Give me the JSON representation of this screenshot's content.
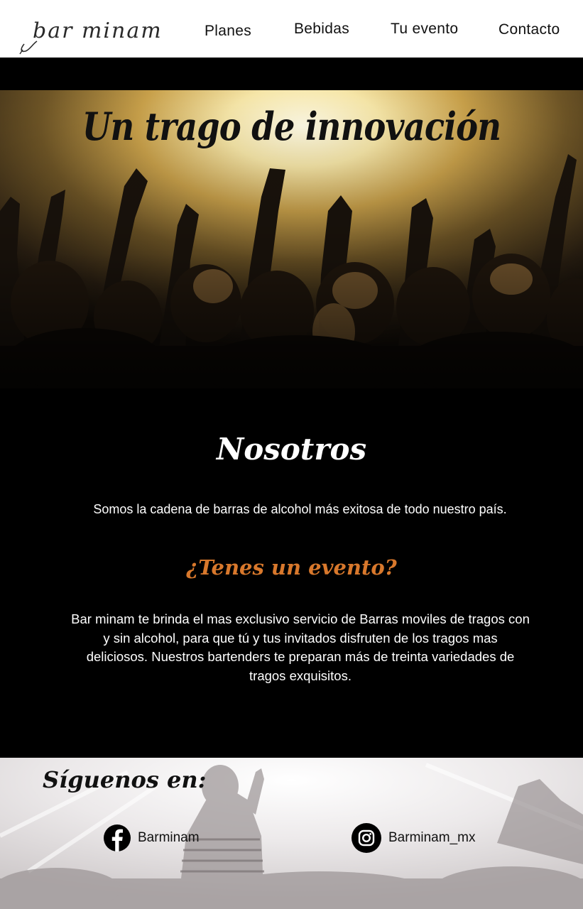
{
  "header": {
    "logo_text": "bar minam",
    "nav": [
      {
        "label": "Planes"
      },
      {
        "label": "Bebidas"
      },
      {
        "label": "Tu evento"
      },
      {
        "label": "Contacto"
      }
    ]
  },
  "hero": {
    "title": "Un trago de innovación"
  },
  "about": {
    "title": "Nosotros",
    "text": "Somos la cadena de barras de alcohol más exitosa de todo nuestro país.",
    "event_title": "¿Tenes un evento?",
    "event_text": "Bar minam te brinda el mas exclusivo servicio de Barras moviles de tragos con y sin alcohol, para que tú y tus invitados disfruten de los tragos mas deliciosos.  Nuestros bartenders te preparan más de treinta variedades de tragos exquisitos."
  },
  "footer": {
    "follow_title": "Síguenos en:",
    "social": [
      {
        "network": "facebook",
        "icon": "facebook-icon",
        "handle": "Barminam"
      },
      {
        "network": "instagram",
        "icon": "instagram-icon",
        "handle": "Barminam_mx"
      }
    ]
  },
  "colors": {
    "header_bg": "#ffffff",
    "page_bg": "#000000",
    "accent": "#d8782c",
    "text_light": "#ffffff",
    "text_dark": "#111111"
  }
}
